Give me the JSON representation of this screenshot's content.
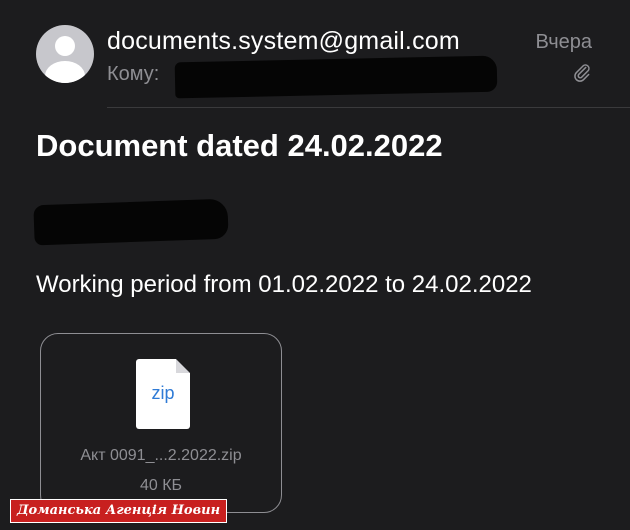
{
  "header": {
    "sender": "documents.system@gmail.com",
    "date": "Вчера",
    "to_label": "Кому:",
    "attachment_indicator_icon": "paperclip-icon"
  },
  "message": {
    "subject": "Document dated 24.02.2022",
    "body": "Working period from 01.02.2022 to 24.02.2022"
  },
  "attachment": {
    "type_label": "zip",
    "filename": "Акт 0091_...2.2022.zip",
    "size": "40 КБ",
    "icon": "zip-file-icon"
  },
  "watermark": {
    "text": "Доманська Агенція Новин"
  },
  "colors": {
    "background": "#1c1c1e",
    "secondary_text": "#8e8e93",
    "file_accent": "#2f7bd6",
    "watermark": "#c8201f"
  }
}
